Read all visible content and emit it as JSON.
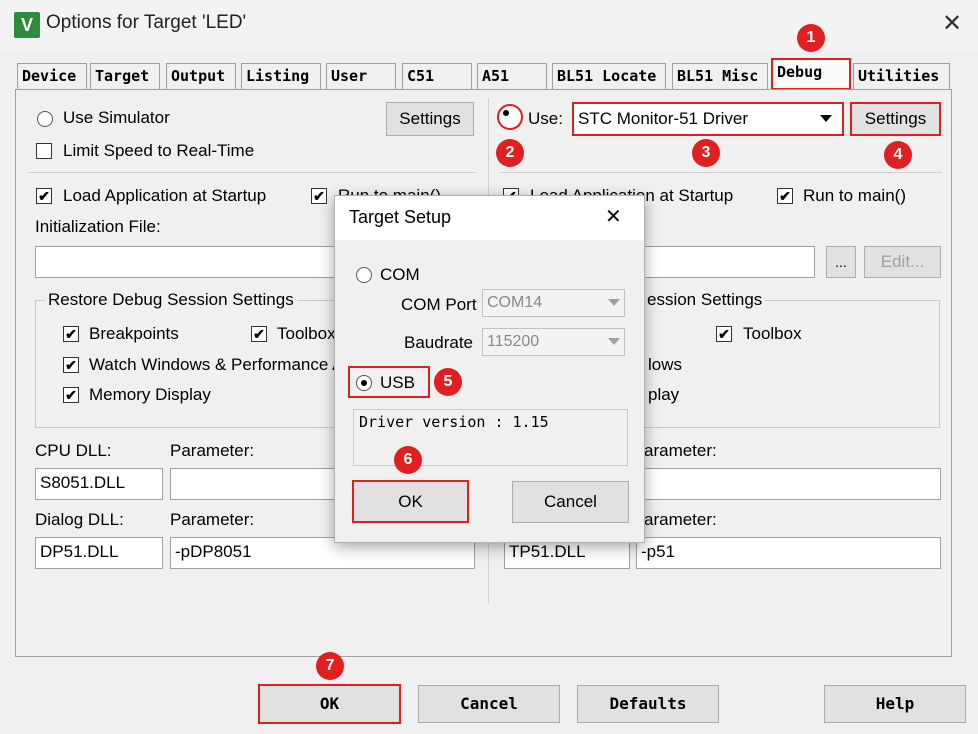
{
  "window": {
    "title": "Options for Target 'LED'",
    "icon_glyph": "V"
  },
  "tabs": [
    "Device",
    "Target",
    "Output",
    "Listing",
    "User",
    "C51",
    "A51",
    "BL51 Locate",
    "BL51 Misc",
    "Debug",
    "Utilities"
  ],
  "left": {
    "use_simulator": "Use Simulator",
    "settings": "Settings",
    "limit_speed": "Limit Speed to Real-Time",
    "load_app": "Load Application at Startup",
    "run_to_main": "Run to main()",
    "init_file": "Initialization File:",
    "restore_group": "Restore Debug Session Settings",
    "breakpoints": "Breakpoints",
    "toolbox": "Toolbox",
    "watch_windows": "Watch Windows & Performance Analyzer",
    "memory_display": "Memory Display",
    "cpu_dll_label": "CPU DLL:",
    "cpu_param_label": "Parameter:",
    "cpu_dll": "S8051.DLL",
    "cpu_param": "",
    "dialog_dll_label": "Dialog DLL:",
    "dialog_param_label": "Parameter:",
    "dialog_dll": "DP51.DLL",
    "dialog_param": "-pDP8051"
  },
  "right": {
    "use_label": "Use:",
    "driver": "STC Monitor-51 Driver",
    "settings": "Settings",
    "load_app": "Load Application at Startup",
    "run_to_main": "Run to main()",
    "ellipsis": "...",
    "edit": "Edit...",
    "restore_group_partial": "ession Settings",
    "toolbox": "Toolbox",
    "watch_partial": "lows",
    "memory_partial": "play",
    "cpu_param_label_partial": "arameter:",
    "dialog_param_label_partial": "arameter:",
    "dialog_dll": "TP51.DLL",
    "dialog_param": "-p51"
  },
  "dialog": {
    "title": "Target Setup",
    "com": "COM",
    "com_port_label": "COM Port",
    "com_port": "COM14",
    "baudrate_label": "Baudrate",
    "baudrate": "115200",
    "usb": "USB",
    "driver_version": "Driver version : 1.15",
    "ok": "OK",
    "cancel": "Cancel"
  },
  "bottom": {
    "ok": "OK",
    "cancel": "Cancel",
    "defaults": "Defaults",
    "help": "Help"
  },
  "badges": [
    "1",
    "2",
    "3",
    "4",
    "5",
    "6",
    "7"
  ],
  "colors": {
    "highlight": "#e02020"
  }
}
